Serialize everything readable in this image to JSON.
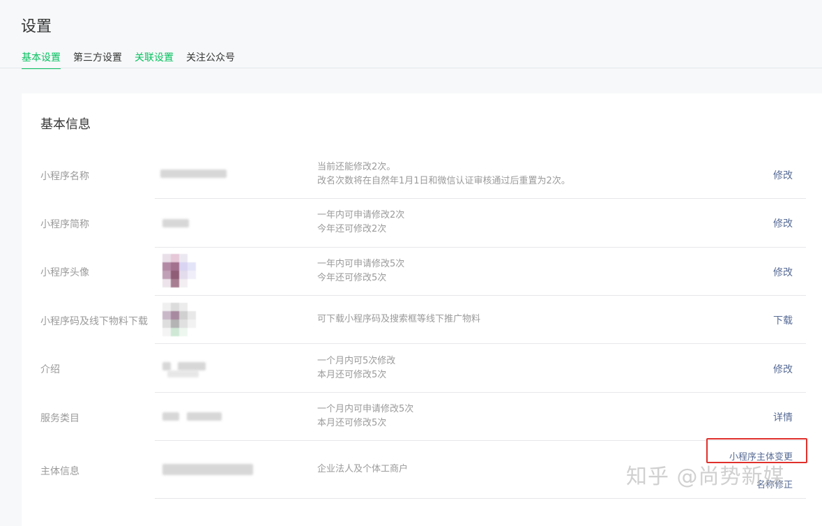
{
  "page": {
    "title": "设置"
  },
  "tabs": [
    {
      "label": "基本设置",
      "state": "active"
    },
    {
      "label": "第三方设置",
      "state": "normal"
    },
    {
      "label": "关联设置",
      "state": "green"
    },
    {
      "label": "关注公众号",
      "state": "normal"
    }
  ],
  "card": {
    "title": "基本信息"
  },
  "rows": [
    {
      "label": "小程序名称",
      "desc1": "当前还能修改2次。",
      "desc2": "改名次数将在自然年1月1日和微信认证审核通过后重置为2次。",
      "action": "修改"
    },
    {
      "label": "小程序简称",
      "desc1": "一年内可申请修改2次",
      "desc2": "今年还可修改2次",
      "action": "修改"
    },
    {
      "label": "小程序头像",
      "desc1": "一年内可申请修改5次",
      "desc2": "今年还可修改5次",
      "action": "修改"
    },
    {
      "label": "小程序码及线下物料下载",
      "desc1": "可下载小程序码及搜索框等线下推广物料",
      "desc2": "",
      "action": "下载"
    },
    {
      "label": "介绍",
      "desc1": "一个月内可5次修改",
      "desc2": "本月还可修改5次",
      "action": "修改"
    },
    {
      "label": "服务类目",
      "desc1": "一个月内可申请修改5次",
      "desc2": "本月还可修改5次",
      "action": "详情"
    },
    {
      "label": "主体信息",
      "desc1": "企业法人及个体工商户",
      "desc2": "",
      "action": "小程序主体变更",
      "action2": "名称修正"
    }
  ],
  "watermark": "知乎 @尚势新媒",
  "colors": {
    "accent": "#07c160",
    "link": "#576b95",
    "highlight": "#e0302b"
  }
}
